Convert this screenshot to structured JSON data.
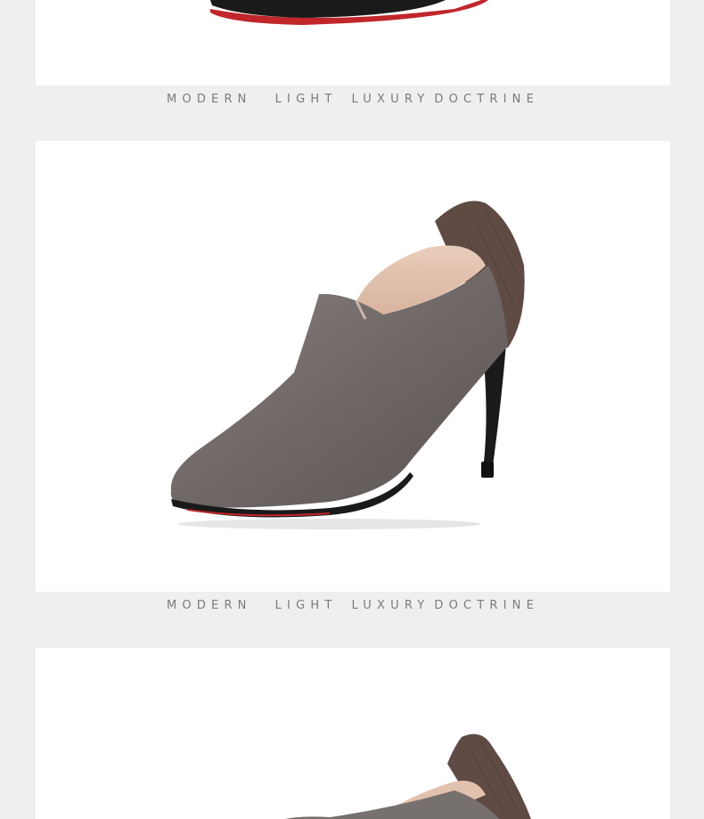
{
  "sections": [
    {
      "image_alt": "black pointed heel, red sole",
      "caption": {
        "w1": "MODERN",
        "w2": "LIGHT",
        "w3": "LUXURY",
        "w4": "DOCTRINE"
      }
    },
    {
      "image_alt": "grey leather pointed stiletto ankle bootie",
      "caption": {
        "w1": "MODERN",
        "w2": "LIGHT",
        "w3": "LUXURY",
        "w4": "DOCTRINE"
      }
    },
    {
      "image_alt": "grey leather bootie, partial view"
    }
  ],
  "colors": {
    "background": "#efefef",
    "panel": "#ffffff",
    "caption_text": "#7a7a7a",
    "leather_grey": "#6f6866",
    "heel_black": "#1a1a1a",
    "sole_red": "#c0262a"
  }
}
